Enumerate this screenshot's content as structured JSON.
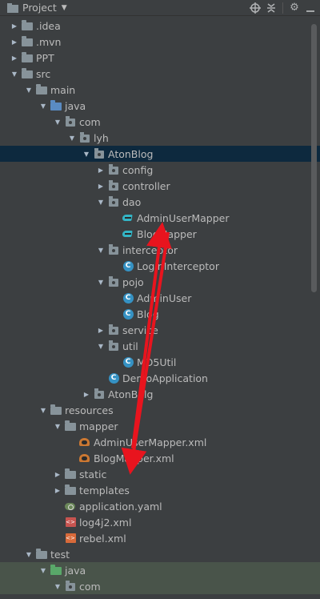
{
  "header": {
    "title": "Project",
    "tools": [
      "target-icon",
      "collapse-icon",
      "gear-icon",
      "hide-icon"
    ]
  },
  "tree": [
    {
      "label": ".idea",
      "depth": 0,
      "expanded": false,
      "icon": "folder"
    },
    {
      "label": ".mvn",
      "depth": 0,
      "expanded": false,
      "icon": "folder"
    },
    {
      "label": "PPT",
      "depth": 0,
      "expanded": false,
      "icon": "folder"
    },
    {
      "label": "src",
      "depth": 0,
      "expanded": true,
      "icon": "folder"
    },
    {
      "label": "main",
      "depth": 1,
      "expanded": true,
      "icon": "folder"
    },
    {
      "label": "java",
      "depth": 2,
      "expanded": true,
      "icon": "folder-src"
    },
    {
      "label": "com",
      "depth": 3,
      "expanded": true,
      "icon": "package"
    },
    {
      "label": "lyh",
      "depth": 4,
      "expanded": true,
      "icon": "package"
    },
    {
      "label": "AtonBlog",
      "depth": 5,
      "expanded": true,
      "icon": "package",
      "selected": true
    },
    {
      "label": "config",
      "depth": 6,
      "expanded": false,
      "icon": "package"
    },
    {
      "label": "controller",
      "depth": 6,
      "expanded": false,
      "icon": "package"
    },
    {
      "label": "dao",
      "depth": 6,
      "expanded": true,
      "icon": "package"
    },
    {
      "label": "AdminUserMapper",
      "depth": 7,
      "icon": "interface"
    },
    {
      "label": "BlogMapper",
      "depth": 7,
      "icon": "interface"
    },
    {
      "label": "interceptor",
      "depth": 6,
      "expanded": true,
      "icon": "package"
    },
    {
      "label": "LoginInterceptor",
      "depth": 7,
      "icon": "class"
    },
    {
      "label": "pojo",
      "depth": 6,
      "expanded": true,
      "icon": "package"
    },
    {
      "label": "AdminUser",
      "depth": 7,
      "icon": "class"
    },
    {
      "label": "Blog",
      "depth": 7,
      "icon": "class"
    },
    {
      "label": "service",
      "depth": 6,
      "expanded": false,
      "icon": "package"
    },
    {
      "label": "util",
      "depth": 6,
      "expanded": true,
      "icon": "package"
    },
    {
      "label": "MD5Util",
      "depth": 7,
      "icon": "class"
    },
    {
      "label": "DemoApplication",
      "depth": 6,
      "icon": "class"
    },
    {
      "label": "AtonBolg",
      "depth": 5,
      "expanded": false,
      "icon": "package"
    },
    {
      "label": "resources",
      "depth": 2,
      "expanded": true,
      "icon": "folder"
    },
    {
      "label": "mapper",
      "depth": 3,
      "expanded": true,
      "icon": "folder"
    },
    {
      "label": "AdminUserMapper.xml",
      "depth": 4,
      "icon": "xml"
    },
    {
      "label": "BlogMapper.xml",
      "depth": 4,
      "icon": "xml"
    },
    {
      "label": "static",
      "depth": 3,
      "expanded": false,
      "icon": "folder"
    },
    {
      "label": "templates",
      "depth": 3,
      "expanded": false,
      "icon": "folder"
    },
    {
      "label": "application.yaml",
      "depth": 3,
      "icon": "yaml"
    },
    {
      "label": "log4j2.xml",
      "depth": 3,
      "icon": "log"
    },
    {
      "label": "rebel.xml",
      "depth": 3,
      "icon": "rebel"
    },
    {
      "label": "test",
      "depth": 1,
      "expanded": true,
      "icon": "folder"
    },
    {
      "label": "java",
      "depth": 2,
      "expanded": true,
      "icon": "folder-test",
      "green": true
    },
    {
      "label": "com",
      "depth": 3,
      "expanded": true,
      "icon": "package",
      "green": true
    }
  ],
  "annotation_color": "#e8141e"
}
